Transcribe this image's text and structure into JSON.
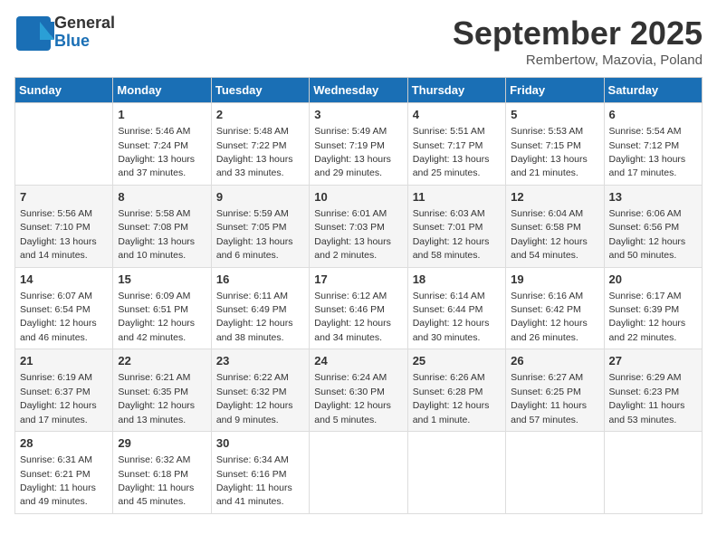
{
  "header": {
    "logo": {
      "general": "General",
      "blue": "Blue"
    },
    "title": "September 2025",
    "subtitle": "Rembertow, Mazovia, Poland"
  },
  "days_of_week": [
    "Sunday",
    "Monday",
    "Tuesday",
    "Wednesday",
    "Thursday",
    "Friday",
    "Saturday"
  ],
  "weeks": [
    [
      {
        "day": "",
        "info": ""
      },
      {
        "day": "1",
        "info": "Sunrise: 5:46 AM\nSunset: 7:24 PM\nDaylight: 13 hours and 37 minutes."
      },
      {
        "day": "2",
        "info": "Sunrise: 5:48 AM\nSunset: 7:22 PM\nDaylight: 13 hours and 33 minutes."
      },
      {
        "day": "3",
        "info": "Sunrise: 5:49 AM\nSunset: 7:19 PM\nDaylight: 13 hours and 29 minutes."
      },
      {
        "day": "4",
        "info": "Sunrise: 5:51 AM\nSunset: 7:17 PM\nDaylight: 13 hours and 25 minutes."
      },
      {
        "day": "5",
        "info": "Sunrise: 5:53 AM\nSunset: 7:15 PM\nDaylight: 13 hours and 21 minutes."
      },
      {
        "day": "6",
        "info": "Sunrise: 5:54 AM\nSunset: 7:12 PM\nDaylight: 13 hours and 17 minutes."
      }
    ],
    [
      {
        "day": "7",
        "info": "Sunrise: 5:56 AM\nSunset: 7:10 PM\nDaylight: 13 hours and 14 minutes."
      },
      {
        "day": "8",
        "info": "Sunrise: 5:58 AM\nSunset: 7:08 PM\nDaylight: 13 hours and 10 minutes."
      },
      {
        "day": "9",
        "info": "Sunrise: 5:59 AM\nSunset: 7:05 PM\nDaylight: 13 hours and 6 minutes."
      },
      {
        "day": "10",
        "info": "Sunrise: 6:01 AM\nSunset: 7:03 PM\nDaylight: 13 hours and 2 minutes."
      },
      {
        "day": "11",
        "info": "Sunrise: 6:03 AM\nSunset: 7:01 PM\nDaylight: 12 hours and 58 minutes."
      },
      {
        "day": "12",
        "info": "Sunrise: 6:04 AM\nSunset: 6:58 PM\nDaylight: 12 hours and 54 minutes."
      },
      {
        "day": "13",
        "info": "Sunrise: 6:06 AM\nSunset: 6:56 PM\nDaylight: 12 hours and 50 minutes."
      }
    ],
    [
      {
        "day": "14",
        "info": "Sunrise: 6:07 AM\nSunset: 6:54 PM\nDaylight: 12 hours and 46 minutes."
      },
      {
        "day": "15",
        "info": "Sunrise: 6:09 AM\nSunset: 6:51 PM\nDaylight: 12 hours and 42 minutes."
      },
      {
        "day": "16",
        "info": "Sunrise: 6:11 AM\nSunset: 6:49 PM\nDaylight: 12 hours and 38 minutes."
      },
      {
        "day": "17",
        "info": "Sunrise: 6:12 AM\nSunset: 6:46 PM\nDaylight: 12 hours and 34 minutes."
      },
      {
        "day": "18",
        "info": "Sunrise: 6:14 AM\nSunset: 6:44 PM\nDaylight: 12 hours and 30 minutes."
      },
      {
        "day": "19",
        "info": "Sunrise: 6:16 AM\nSunset: 6:42 PM\nDaylight: 12 hours and 26 minutes."
      },
      {
        "day": "20",
        "info": "Sunrise: 6:17 AM\nSunset: 6:39 PM\nDaylight: 12 hours and 22 minutes."
      }
    ],
    [
      {
        "day": "21",
        "info": "Sunrise: 6:19 AM\nSunset: 6:37 PM\nDaylight: 12 hours and 17 minutes."
      },
      {
        "day": "22",
        "info": "Sunrise: 6:21 AM\nSunset: 6:35 PM\nDaylight: 12 hours and 13 minutes."
      },
      {
        "day": "23",
        "info": "Sunrise: 6:22 AM\nSunset: 6:32 PM\nDaylight: 12 hours and 9 minutes."
      },
      {
        "day": "24",
        "info": "Sunrise: 6:24 AM\nSunset: 6:30 PM\nDaylight: 12 hours and 5 minutes."
      },
      {
        "day": "25",
        "info": "Sunrise: 6:26 AM\nSunset: 6:28 PM\nDaylight: 12 hours and 1 minute."
      },
      {
        "day": "26",
        "info": "Sunrise: 6:27 AM\nSunset: 6:25 PM\nDaylight: 11 hours and 57 minutes."
      },
      {
        "day": "27",
        "info": "Sunrise: 6:29 AM\nSunset: 6:23 PM\nDaylight: 11 hours and 53 minutes."
      }
    ],
    [
      {
        "day": "28",
        "info": "Sunrise: 6:31 AM\nSunset: 6:21 PM\nDaylight: 11 hours and 49 minutes."
      },
      {
        "day": "29",
        "info": "Sunrise: 6:32 AM\nSunset: 6:18 PM\nDaylight: 11 hours and 45 minutes."
      },
      {
        "day": "30",
        "info": "Sunrise: 6:34 AM\nSunset: 6:16 PM\nDaylight: 11 hours and 41 minutes."
      },
      {
        "day": "",
        "info": ""
      },
      {
        "day": "",
        "info": ""
      },
      {
        "day": "",
        "info": ""
      },
      {
        "day": "",
        "info": ""
      }
    ]
  ]
}
